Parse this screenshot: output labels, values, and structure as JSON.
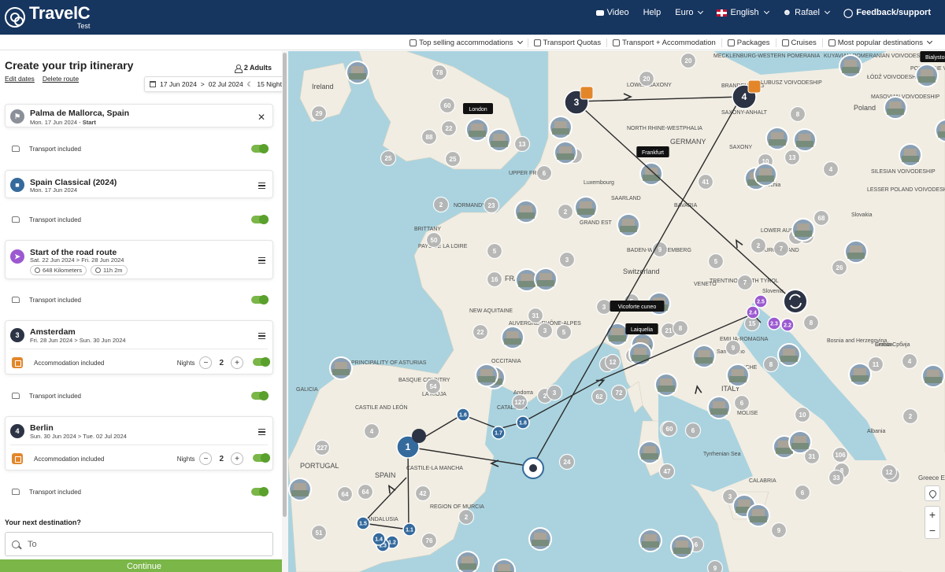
{
  "header": {
    "logo_name": "TravelC",
    "logo_sub": "Test",
    "nav": {
      "video": "Video",
      "help": "Help",
      "currency": "Euro",
      "language": "English",
      "user": "Rafael",
      "feedback": "Feedback/support"
    }
  },
  "subnav": [
    {
      "label": "Top selling accommodations",
      "icon": "hotel-icon",
      "dropdown": true
    },
    {
      "label": "Transport Quotas",
      "icon": "ticket-icon",
      "dropdown": false
    },
    {
      "label": "Transport + Accommodation",
      "icon": "bed-icon",
      "dropdown": false
    },
    {
      "label": "Packages",
      "icon": "suitcase-icon",
      "dropdown": false
    },
    {
      "label": "Cruises",
      "icon": "ship-icon",
      "dropdown": false
    },
    {
      "label": "Most popular destinations",
      "icon": "pin-icon",
      "dropdown": true
    }
  ],
  "itinerary": {
    "title": "Create your trip itinerary",
    "adults": "2 Adults",
    "edit_dates": "Edit dates",
    "delete_route": "Delete route",
    "date_from": "17 Jun 2024",
    "date_to": "02 Jul 2024",
    "nights": "15 Nights",
    "transport_label": "Transport included",
    "accommodation_label": "Accommodation included",
    "nights_label": "Nights",
    "start": {
      "name": "Palma de Mallorca, Spain",
      "date": "Mon. 17 Jun 2024 -",
      "tag": "Start"
    },
    "package": {
      "name": "Spain Classical (2024)",
      "date": "Mon. 17 Jun 2024"
    },
    "road": {
      "name": "Start of the road route",
      "date": "Sat. 22 Jun 2024 > Fri. 28 Jun 2024",
      "distance": "648 Kilometers",
      "duration": "11h 2m"
    },
    "stops": [
      {
        "index": "3",
        "name": "Amsterdam",
        "date": "Fri. 28 Jun 2024 > Sun. 30 Jun 2024",
        "nights": "2"
      },
      {
        "index": "4",
        "name": "Berlin",
        "date": "Sun. 30 Jun 2024 > Tue. 02 Jul 2024",
        "nights": "2"
      }
    ],
    "next_destination": "Your next destination?",
    "to_placeholder": "To",
    "continue": "Continue"
  },
  "map": {
    "colors": {
      "sea": "#aad3df",
      "land": "#f1ede3",
      "route": "#2b2b2b",
      "marker_blue": "#356a9c",
      "marker_purple": "#9b59d0",
      "marker_dark": "#2c3344",
      "cluster": "#b4b4b4"
    },
    "regions": [
      {
        "text": "Ireland"
      },
      {
        "text": "FRANCE"
      },
      {
        "text": "SPAIN"
      },
      {
        "text": "PORTUGAL"
      },
      {
        "text": "ITALY"
      },
      {
        "text": "GERMANY"
      },
      {
        "text": "Switzerland"
      },
      {
        "text": "Slovenia"
      },
      {
        "text": "Poland"
      },
      {
        "text": "Czechia"
      },
      {
        "text": "Slovakia"
      },
      {
        "text": "Croatia"
      },
      {
        "text": "Bosnia and Herzegovina"
      },
      {
        "text": "Serbia Србија"
      },
      {
        "text": "Albania"
      },
      {
        "text": "Greece Ελλάδα"
      },
      {
        "text": "BRITTANY"
      },
      {
        "text": "PAYS DE LA LOIRE"
      },
      {
        "text": "NORMANDY"
      },
      {
        "text": "GRAND EST"
      },
      {
        "text": "NEW AQUITAINE"
      },
      {
        "text": "AUVERGNE-RHÔNE-ALPES"
      },
      {
        "text": "OCCITANIA"
      },
      {
        "text": "BASQUE COUNTRY"
      },
      {
        "text": "LA RIOJA"
      },
      {
        "text": "CATALONIA"
      },
      {
        "text": "CASTILE AND LEÓN"
      },
      {
        "text": "GALICIA"
      },
      {
        "text": "CASTILE-LA MANCHA"
      },
      {
        "text": "REGION OF MURCIA"
      },
      {
        "text": "ANDALUSIA"
      },
      {
        "text": "PRINCIPALITY OF ASTURIAS"
      },
      {
        "text": "BAVARIA"
      },
      {
        "text": "SAXONY"
      },
      {
        "text": "SAXONY-ANHALT"
      },
      {
        "text": "LOWER SAXONY"
      },
      {
        "text": "NORTH RHINE-WESTPHALIA"
      },
      {
        "text": "BADEN-WÜRTTEMBERG"
      },
      {
        "text": "SAARLAND"
      },
      {
        "text": "Luxembourg"
      },
      {
        "text": "UPPER FRANCE"
      },
      {
        "text": "LUBUSZ VOIVODESHIP"
      },
      {
        "text": "SILESIAN VOIVODESHIP"
      },
      {
        "text": "LESSER POLAND VOIVODESHIP"
      },
      {
        "text": "MASOVIAN VOIVODESHIP"
      },
      {
        "text": "ŁÓDŹ VOIVODESHIP"
      },
      {
        "text": "LOWER AUSTRIA"
      },
      {
        "text": "BURGENLAND"
      },
      {
        "text": "TRENTINO-SOUTH TYROL"
      },
      {
        "text": "VENETO"
      },
      {
        "text": "EMILIA-ROMAGNA"
      },
      {
        "text": "MARCHE"
      },
      {
        "text": "MOLISE"
      },
      {
        "text": "CALABRIA"
      },
      {
        "text": "Tyrrhenian Sea"
      },
      {
        "text": "San Marino"
      },
      {
        "text": "Andorra"
      },
      {
        "text": "MECKLENBURG-WESTERN POMERANIA"
      },
      {
        "text": "BRANDENBURG"
      },
      {
        "text": "KUYAVIAN-POMERANIAN VOIVODESHIP"
      },
      {
        "text": "PODLASKIE VOIVODESHIP"
      }
    ],
    "clusters": [
      "20",
      "78",
      "29",
      "60",
      "20",
      "22",
      "25",
      "88",
      "13",
      "25",
      "6",
      "7",
      "2",
      "23",
      "2",
      "50",
      "5",
      "3",
      "16",
      "5",
      "3",
      "31",
      "22",
      "5",
      "3",
      "21",
      "64",
      "54",
      "2",
      "24",
      "48",
      "33",
      "72",
      "62",
      "26",
      "15",
      "41",
      "8",
      "4",
      "13",
      "10",
      "16",
      "7",
      "68",
      "3",
      "127",
      "3",
      "8",
      "8",
      "12",
      "5",
      "2",
      "9",
      "4",
      "5",
      "7",
      "9",
      "8",
      "8",
      "6",
      "60",
      "6",
      "47",
      "3",
      "42",
      "2",
      "64",
      "227",
      "4",
      "76",
      "51",
      "6",
      "9",
      "9",
      "33",
      "8",
      "11",
      "4",
      "2",
      "6",
      "31",
      "10",
      "106",
      "12",
      "33"
    ],
    "tooltips": [
      "London",
      "Frankfurt",
      "Vicoforte cuneo",
      "Laiquelia",
      "Bialystok"
    ],
    "route_markers": [
      "1",
      "1.1",
      "1.2",
      "1.3",
      "1.4",
      "1.5",
      "1.6",
      "1.7",
      "1.8",
      "2.2",
      "2.3",
      "2.4",
      "2.5",
      "3",
      "4"
    ]
  },
  "controls": {
    "zoom_in": "+",
    "zoom_out": "−"
  }
}
